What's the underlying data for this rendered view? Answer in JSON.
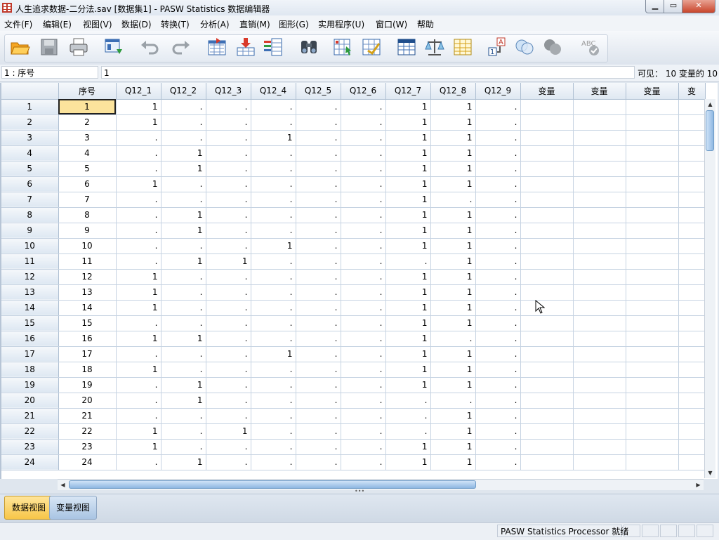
{
  "window": {
    "title": "人生追求数据-二分法.sav [数据集1] - PASW Statistics 数据编辑器"
  },
  "window_buttons": {
    "minimize": "▁",
    "maximize": "▭",
    "close": "✕"
  },
  "menu": [
    "文件(F)",
    "编辑(E)",
    "视图(V)",
    "数据(D)",
    "转换(T)",
    "分析(A)",
    "直销(M)",
    "图形(G)",
    "实用程序(U)",
    "窗口(W)",
    "帮助"
  ],
  "toolbar": {
    "icons": [
      "open-folder-icon",
      "save-icon",
      "print-icon",
      "dialog-recall-icon",
      "undo-icon",
      "redo-icon",
      "goto-case-icon",
      "goto-variable-icon",
      "variables-icon",
      "find-icon",
      "insert-cases-icon",
      "insert-variable-icon",
      "split-file-icon",
      "weight-cases-icon",
      "select-cases-icon",
      "value-labels-icon",
      "use-sets-icon",
      "show-all-variables-icon",
      "spell-check-icon"
    ]
  },
  "cell_editor": {
    "ref": "1 : 序号",
    "value": "1",
    "visible": "可见： 10 变量的 10"
  },
  "grid": {
    "columns": [
      "序号",
      "Q12_1",
      "Q12_2",
      "Q12_3",
      "Q12_4",
      "Q12_5",
      "Q12_6",
      "Q12_7",
      "Q12_8",
      "Q12_9",
      "变量",
      "变量",
      "变量",
      "变"
    ],
    "rows": [
      [
        "1",
        "1",
        "1",
        ".",
        ".",
        ".",
        ".",
        ".",
        "1",
        "1",
        "."
      ],
      [
        "2",
        "2",
        "1",
        ".",
        ".",
        ".",
        ".",
        ".",
        "1",
        "1",
        "."
      ],
      [
        "3",
        "3",
        ".",
        ".",
        ".",
        "1",
        ".",
        ".",
        "1",
        "1",
        "."
      ],
      [
        "4",
        "4",
        ".",
        "1",
        ".",
        ".",
        ".",
        ".",
        "1",
        "1",
        "."
      ],
      [
        "5",
        "5",
        ".",
        "1",
        ".",
        ".",
        ".",
        ".",
        "1",
        "1",
        "."
      ],
      [
        "6",
        "6",
        "1",
        ".",
        ".",
        ".",
        ".",
        ".",
        "1",
        "1",
        "."
      ],
      [
        "7",
        "7",
        ".",
        ".",
        ".",
        ".",
        ".",
        ".",
        "1",
        ".",
        "."
      ],
      [
        "8",
        "8",
        ".",
        "1",
        ".",
        ".",
        ".",
        ".",
        "1",
        "1",
        "."
      ],
      [
        "9",
        "9",
        ".",
        "1",
        ".",
        ".",
        ".",
        ".",
        "1",
        "1",
        "."
      ],
      [
        "10",
        "10",
        ".",
        ".",
        ".",
        "1",
        ".",
        ".",
        "1",
        "1",
        "."
      ],
      [
        "11",
        "11",
        ".",
        "1",
        "1",
        ".",
        ".",
        ".",
        ".",
        "1",
        "."
      ],
      [
        "12",
        "12",
        "1",
        ".",
        ".",
        ".",
        ".",
        ".",
        "1",
        "1",
        "."
      ],
      [
        "13",
        "13",
        "1",
        ".",
        ".",
        ".",
        ".",
        ".",
        "1",
        "1",
        "."
      ],
      [
        "14",
        "14",
        "1",
        ".",
        ".",
        ".",
        ".",
        ".",
        "1",
        "1",
        "."
      ],
      [
        "15",
        "15",
        ".",
        ".",
        ".",
        ".",
        ".",
        ".",
        "1",
        "1",
        "."
      ],
      [
        "16",
        "16",
        "1",
        "1",
        ".",
        ".",
        ".",
        ".",
        "1",
        ".",
        "."
      ],
      [
        "17",
        "17",
        ".",
        ".",
        ".",
        "1",
        ".",
        ".",
        "1",
        "1",
        "."
      ],
      [
        "18",
        "18",
        "1",
        ".",
        ".",
        ".",
        ".",
        ".",
        "1",
        "1",
        "."
      ],
      [
        "19",
        "19",
        ".",
        "1",
        ".",
        ".",
        ".",
        ".",
        "1",
        "1",
        "."
      ],
      [
        "20",
        "20",
        ".",
        "1",
        ".",
        ".",
        ".",
        ".",
        ".",
        ".",
        "."
      ],
      [
        "21",
        "21",
        ".",
        ".",
        ".",
        ".",
        ".",
        ".",
        ".",
        "1",
        "."
      ],
      [
        "22",
        "22",
        "1",
        ".",
        "1",
        ".",
        ".",
        ".",
        ".",
        "1",
        "."
      ],
      [
        "23",
        "23",
        "1",
        ".",
        ".",
        ".",
        ".",
        ".",
        "1",
        "1",
        "."
      ],
      [
        "24",
        "24",
        ".",
        "1",
        ".",
        ".",
        ".",
        ".",
        "1",
        "1",
        "."
      ]
    ]
  },
  "view_tabs": {
    "data_view": "数据视图",
    "variable_view": "变量视图"
  },
  "status": {
    "processor": "PASW Statistics Processor 就绪"
  },
  "colors": {
    "selected_cell": "#fbe39c",
    "header_bg": "#dfe8f2",
    "grid_line": "#c6d3e2",
    "data_tab": "#f7c648"
  }
}
